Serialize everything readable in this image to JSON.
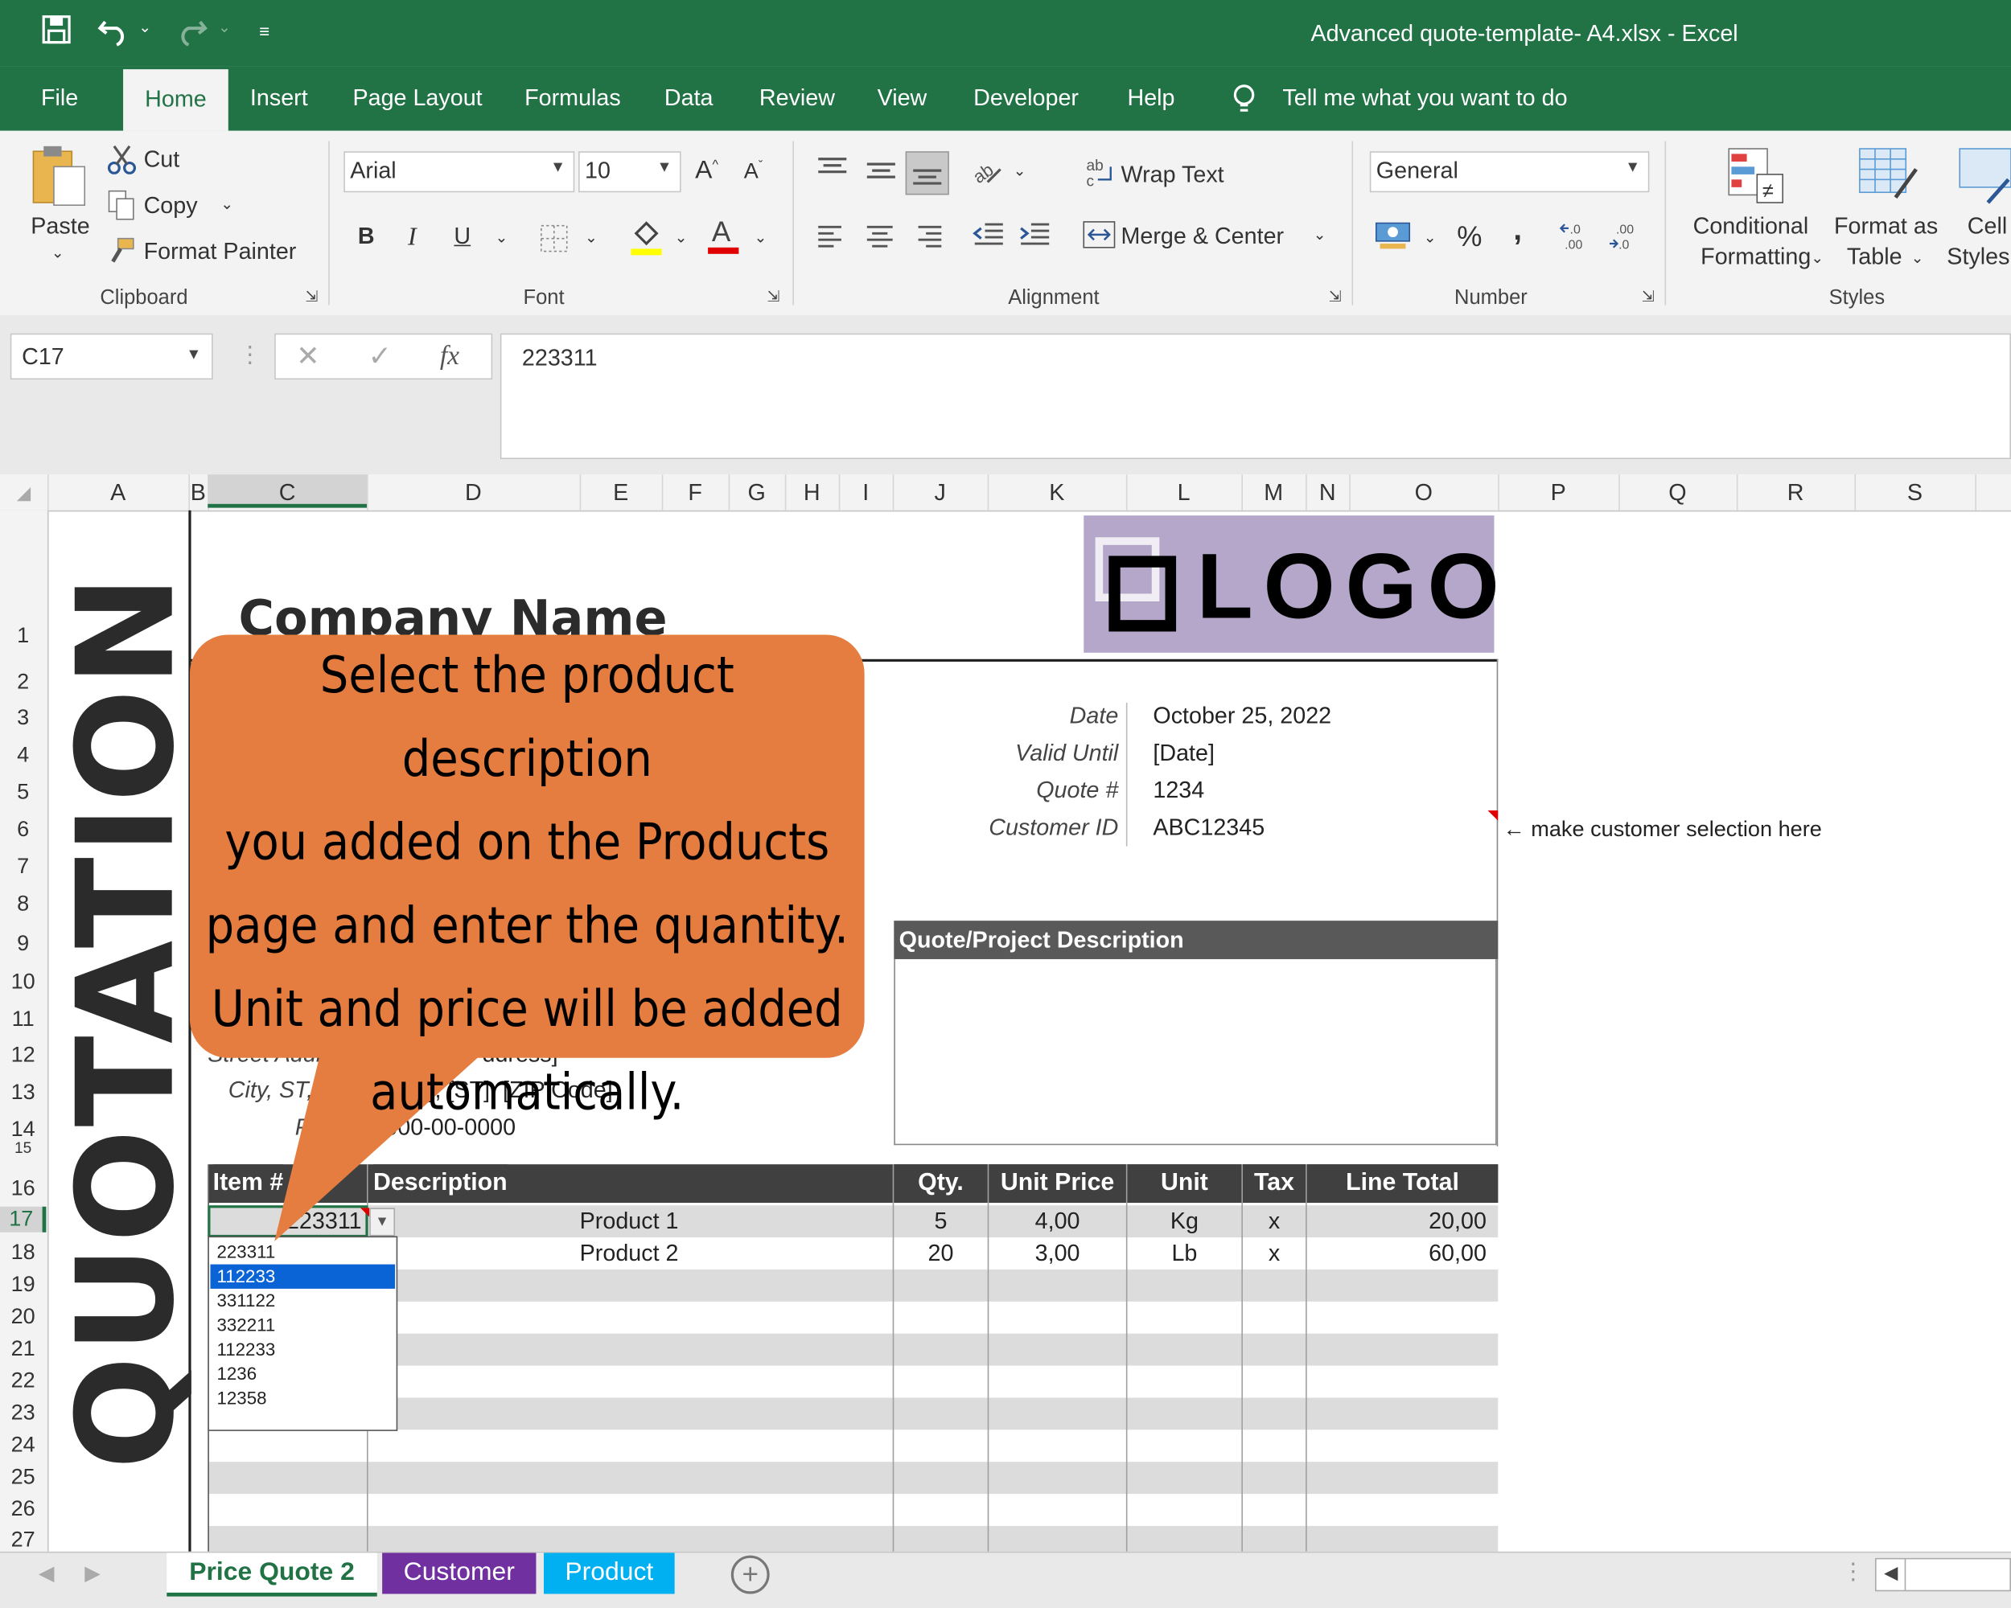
{
  "window": {
    "title": "Advanced quote-template- A4.xlsx  -  Excel"
  },
  "ribbon_tabs": [
    "File",
    "Home",
    "Insert",
    "Page Layout",
    "Formulas",
    "Data",
    "Review",
    "View",
    "Developer",
    "Help"
  ],
  "tell_me": "Tell me what you want to do",
  "clipboard": {
    "paste": "Paste",
    "cut": "Cut",
    "copy": "Copy",
    "format_painter": "Format Painter",
    "label": "Clipboard"
  },
  "font": {
    "name": "Arial",
    "size": "10",
    "label": "Font",
    "bold": "B",
    "italic": "I",
    "underline": "U"
  },
  "alignment": {
    "wrap": "Wrap Text",
    "merge": "Merge & Center",
    "label": "Alignment"
  },
  "number": {
    "format": "General",
    "label": "Number",
    "percent": "%",
    "comma": ","
  },
  "styles": {
    "conditional": "Conditional",
    "formatting": "Formatting",
    "format_as": "Format as",
    "table": "Table",
    "cell": "Cell",
    "cell_styles": "Styles",
    "label": "Styles"
  },
  "formula_bar": {
    "name_box": "C17",
    "fx": "fx",
    "value": "223311"
  },
  "columns": [
    "A",
    "B",
    "C",
    "D",
    "E",
    "F",
    "G",
    "H",
    "I",
    "J",
    "K",
    "L",
    "M",
    "N",
    "O",
    "P",
    "Q",
    "R",
    "S"
  ],
  "rows": [
    "1",
    "2",
    "3",
    "4",
    "5",
    "6",
    "7",
    "8",
    "9",
    "10",
    "11",
    "12",
    "13",
    "14",
    "15",
    "16",
    "17",
    "18",
    "19",
    "20",
    "21",
    "22",
    "23",
    "24",
    "25",
    "26",
    "27"
  ],
  "sheet": {
    "quotation": "QUOTATION",
    "company": "Company Name",
    "logo": "LOGO",
    "date_label": "Date",
    "date_value": "October 25, 2022",
    "valid_label": "Valid Until",
    "valid_value": "[Date]",
    "quote_label": "Quote #",
    "quote_value": "1234",
    "cust_label": "Customer ID",
    "cust_value": "ABC12345",
    "cust_note": "← make customer selection here",
    "desc_header": "Quote/Project Description",
    "street_partial": "Street Addr",
    "street_partial2": "ddress]",
    "city_label": "City, ST,",
    "city_value": "], [ST], [ZIP Code]",
    "phone_label": "P",
    "phone_value": "000-00-0000"
  },
  "table": {
    "headers": [
      "Item #",
      "Description",
      "Qty.",
      "Unit Price",
      "Unit",
      "Tax",
      "Line Total"
    ],
    "rows": [
      {
        "item": "223311",
        "desc": "Product 1",
        "qty": "5",
        "price": "4,00",
        "unit": "Kg",
        "tax": "x",
        "total": "20,00"
      },
      {
        "item": "",
        "desc": "Product 2",
        "qty": "20",
        "price": "3,00",
        "unit": "Lb",
        "tax": "x",
        "total": "60,00"
      }
    ]
  },
  "dropdown": {
    "options": [
      "223311",
      "112233",
      "331122",
      "332211",
      "112233",
      "1236",
      "12358"
    ],
    "selected_index": 1
  },
  "callout": {
    "lines": [
      "Select the product description",
      "you added on the Products",
      "page and enter the quantity.",
      "Unit and price will be added",
      "automatically."
    ]
  },
  "sheet_tabs": [
    {
      "label": "Price Quote 2",
      "color": "#ffffff",
      "text": "#217346"
    },
    {
      "label": "Customer",
      "color": "#7030a0",
      "text": "#ffffff"
    },
    {
      "label": "Product",
      "color": "#00b0f0",
      "text": "#ffffff"
    }
  ],
  "colors": {
    "excel_green": "#217346",
    "header_dark": "#404040",
    "callout": "#e47d3f",
    "logo_bg": "#b4a7c9"
  }
}
